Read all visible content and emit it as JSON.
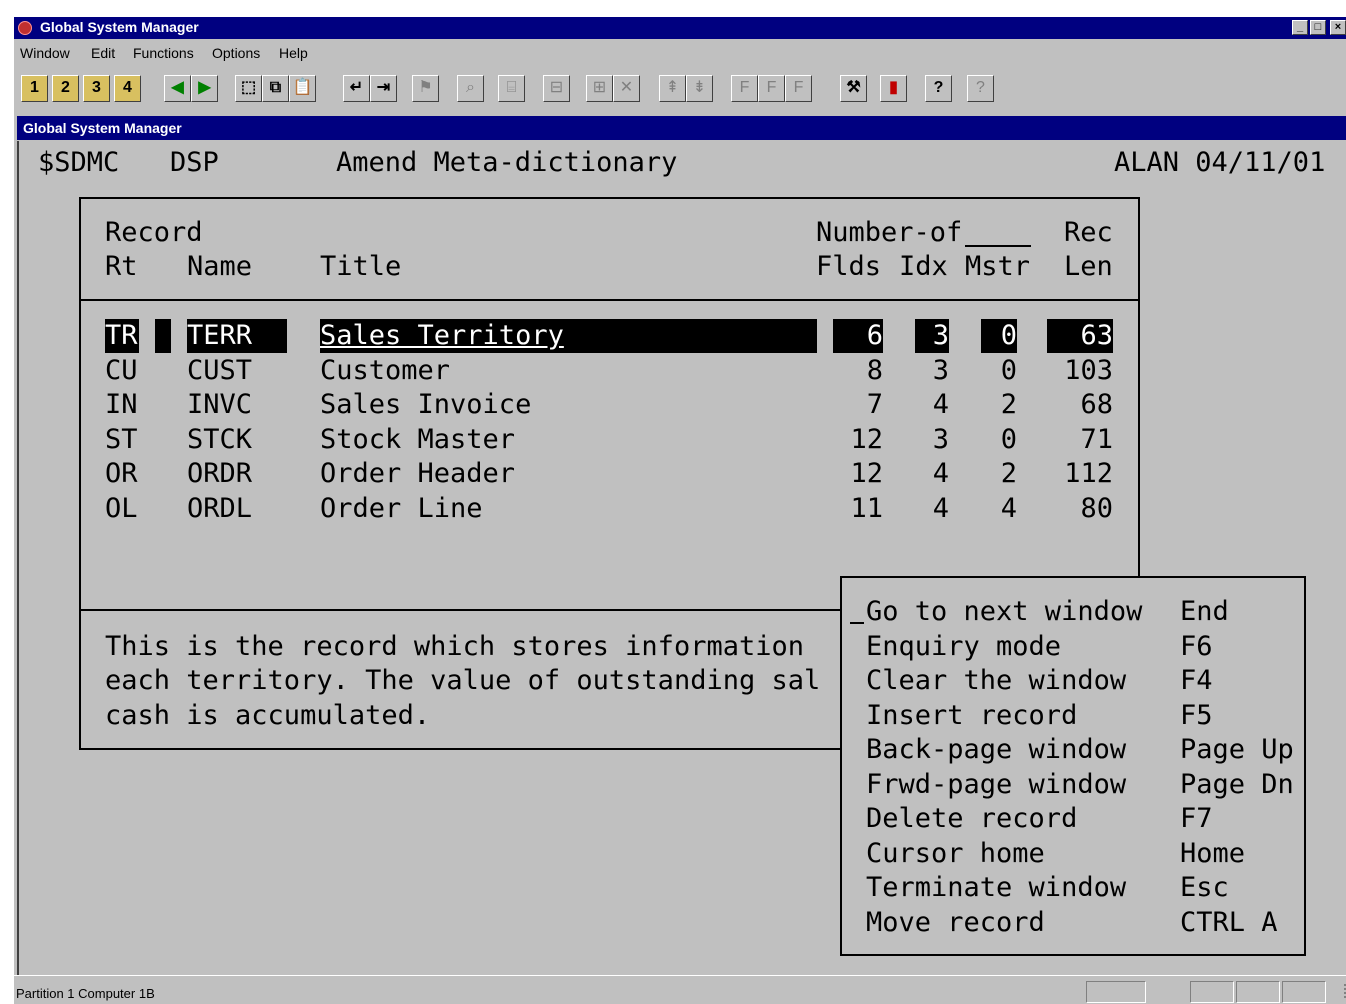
{
  "window": {
    "title": "Global System Manager",
    "controls": [
      "minimize-icon",
      "maximize-icon",
      "close-icon"
    ]
  },
  "menubar": {
    "items": [
      "Window",
      "Edit",
      "Functions",
      "Options",
      "Help"
    ]
  },
  "toolbar": {
    "numbered": [
      "1",
      "2",
      "3",
      "4"
    ]
  },
  "inner_window": {
    "title": "Global System Manager"
  },
  "screen": {
    "program": "$SDMC",
    "mode": "DSP",
    "heading": "Amend Meta-dictionary",
    "user_date": "ALAN 04/11/01",
    "columns": {
      "record": "Record",
      "rt": "Rt",
      "name": "Name",
      "title": "Title",
      "number_of": "Number-of",
      "flds": "Flds",
      "idx": "Idx",
      "mstr": "Mstr",
      "rec": "Rec",
      "len": "Len"
    },
    "rows": [
      {
        "rt": "TR",
        "name": "TERR",
        "title": "Sales Territory",
        "flds": "6",
        "idx": "3",
        "mstr": "0",
        "len": "63"
      },
      {
        "rt": "CU",
        "name": "CUST",
        "title": "Customer",
        "flds": "8",
        "idx": "3",
        "mstr": "0",
        "len": "103"
      },
      {
        "rt": "IN",
        "name": "INVC",
        "title": "Sales Invoice",
        "flds": "7",
        "idx": "4",
        "mstr": "2",
        "len": "68"
      },
      {
        "rt": "ST",
        "name": "STCK",
        "title": "Stock Master",
        "flds": "12",
        "idx": "3",
        "mstr": "0",
        "len": "71"
      },
      {
        "rt": "OR",
        "name": "ORDR",
        "title": "Order Header",
        "flds": "12",
        "idx": "4",
        "mstr": "2",
        "len": "112"
      },
      {
        "rt": "OL",
        "name": "ORDL",
        "title": "Order Line",
        "flds": "11",
        "idx": "4",
        "mstr": "4",
        "len": "80"
      }
    ],
    "description": [
      "This is the record which stores information",
      "each territory. The value of outstanding sal",
      "cash is accumulated."
    ]
  },
  "popup_menu": {
    "items": [
      {
        "label": "Go to next window",
        "key": "End"
      },
      {
        "label": "Enquiry mode",
        "key": "F6"
      },
      {
        "label": "Clear the window",
        "key": "F4"
      },
      {
        "label": "Insert record",
        "key": "F5"
      },
      {
        "label": "Back-page window",
        "key": "Page Up"
      },
      {
        "label": "Frwd-page window",
        "key": "Page Dn"
      },
      {
        "label": "Delete record",
        "key": "F7"
      },
      {
        "label": "Cursor home",
        "key": "Home"
      },
      {
        "label": "Terminate window",
        "key": "Esc"
      },
      {
        "label": "Move record",
        "key": "CTRL A"
      }
    ]
  },
  "statusbar": {
    "text": "Partition 1 Computer 1B"
  }
}
